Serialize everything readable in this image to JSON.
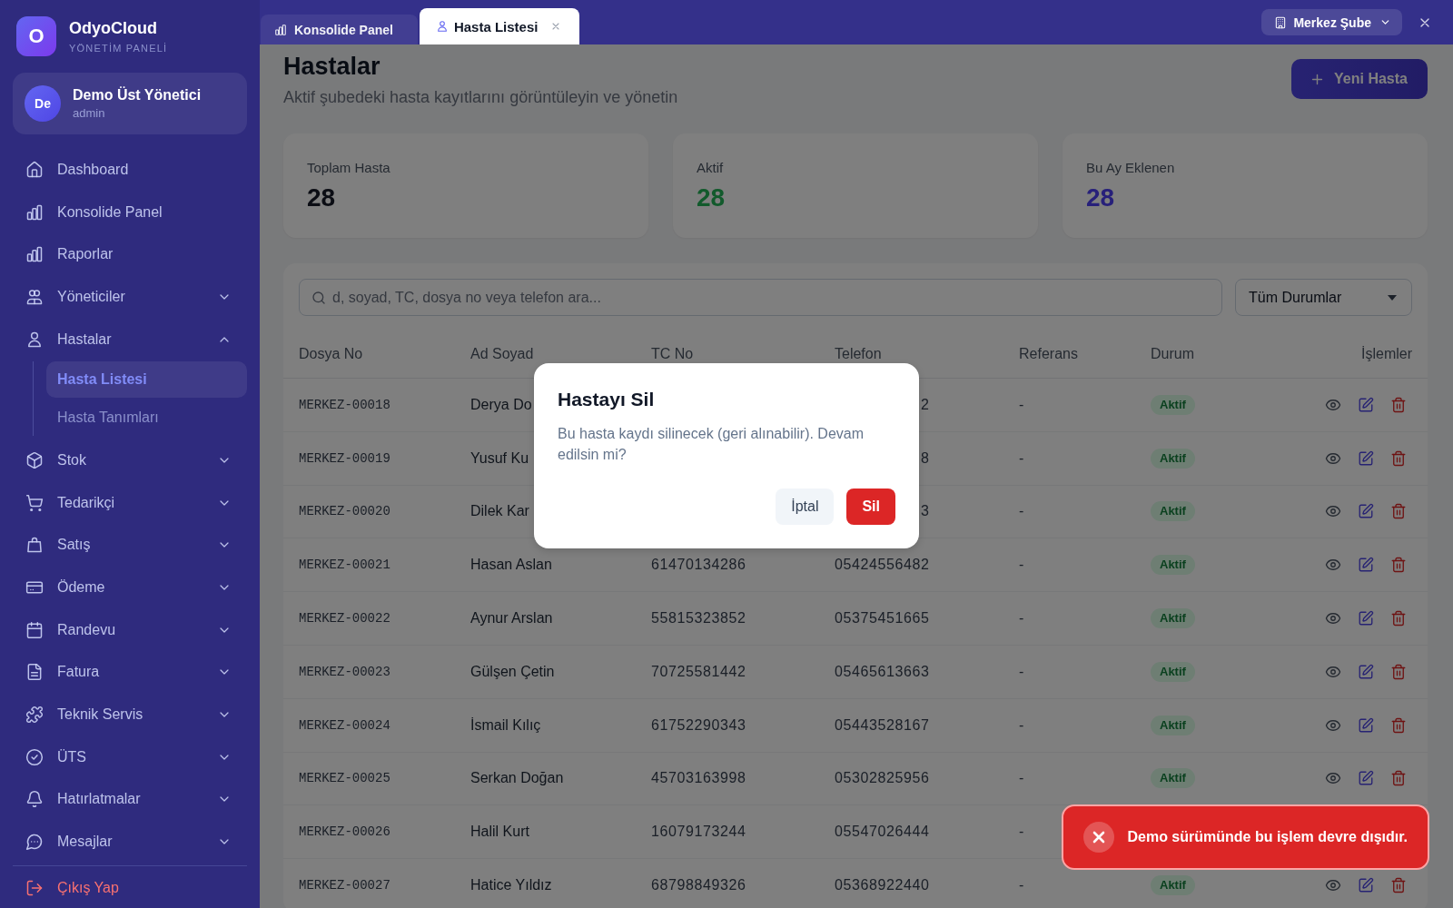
{
  "sidebar": {
    "brand": {
      "logo": "O",
      "name": "OdyoCloud",
      "tagline": "YÖNETİM PANELİ"
    },
    "user": {
      "initials": "De",
      "name": "Demo Üst Yönetici",
      "role": "admin"
    },
    "nav": [
      {
        "label": "Dashboard",
        "selected": false
      },
      {
        "label": "Konsolide Panel",
        "selected": false
      },
      {
        "label": "Raporlar",
        "selected": false
      },
      {
        "label": "Yöneticiler",
        "selected": false,
        "expanded": false
      },
      {
        "label": "Hastalar",
        "selected": false,
        "expanded": true,
        "children": [
          {
            "label": "Hasta Listesi",
            "selected": true
          },
          {
            "label": "Hasta Tanımları",
            "selected": false
          }
        ]
      },
      {
        "label": "Stok",
        "selected": false,
        "expanded": false
      },
      {
        "label": "Tedarikçi",
        "selected": false,
        "expanded": false
      },
      {
        "label": "Satış",
        "selected": false,
        "expanded": false
      },
      {
        "label": "Ödeme",
        "selected": false,
        "expanded": false
      },
      {
        "label": "Randevu",
        "selected": false,
        "expanded": false
      },
      {
        "label": "Fatura",
        "selected": false,
        "expanded": false
      },
      {
        "label": "Teknik Servis",
        "selected": false,
        "expanded": false
      },
      {
        "label": "ÜTS",
        "selected": false,
        "expanded": false
      },
      {
        "label": "Hatırlatmalar",
        "selected": false,
        "expanded": false
      },
      {
        "label": "Mesajlar",
        "selected": false,
        "expanded": false
      }
    ],
    "logout": "Çıkış Yap"
  },
  "topbar": {
    "tabs": [
      {
        "label": "Konsolide Panel",
        "selected": false,
        "closable": false
      },
      {
        "label": "Hasta Listesi",
        "selected": true,
        "closable": true
      }
    ],
    "branch": "Merkez Şube"
  },
  "page": {
    "title": "Hastalar",
    "subtitle": "Aktif şubedeki hasta kayıtlarını görüntüleyin ve yönetin",
    "new_button": "Yeni Hasta"
  },
  "stats": [
    {
      "label": "Toplam Hasta",
      "value": "28",
      "color": "#0b0d14"
    },
    {
      "label": "Aktif",
      "value": "28",
      "color": "#125a2c"
    },
    {
      "label": "Bu Ay Eklenen",
      "value": "28",
      "color": "#27207a"
    }
  ],
  "filters": {
    "search": {
      "placeholder": "d, soyad, TC, dosya no veya telefon ara..."
    },
    "status_select": "Tüm Durumlar"
  },
  "table": {
    "columns": [
      "Dosya No",
      "Ad Soyad",
      "TC No",
      "Telefon",
      "Referans",
      "Durum",
      "İşlemler"
    ],
    "rows": [
      {
        "file_no": "MERKEZ-00018",
        "name": "Derya Do",
        "phone": "2",
        "reference": "-",
        "status": "Aktif",
        "actions": [
          {
            "kind": "view"
          },
          {
            "kind": "edit"
          },
          {
            "kind": "delete"
          }
        ]
      },
      {
        "file_no": "MERKEZ-00019",
        "name": "Yusuf Ku",
        "phone": "8",
        "reference": "-",
        "status": "Aktif",
        "actions": [
          {
            "kind": "view"
          },
          {
            "kind": "edit"
          },
          {
            "kind": "delete"
          }
        ]
      },
      {
        "file_no": "MERKEZ-00020",
        "name": "Dilek Kar",
        "phone": "3",
        "reference": "-",
        "status": "Aktif",
        "actions": [
          {
            "kind": "view"
          },
          {
            "kind": "edit"
          },
          {
            "kind": "delete"
          }
        ]
      },
      {
        "file_no": "MERKEZ-00021",
        "name": "Hasan Aslan",
        "tc": "61470134286",
        "phone": "05424556482",
        "reference": "-",
        "status": "Aktif",
        "actions": [
          {
            "kind": "view"
          },
          {
            "kind": "edit"
          },
          {
            "kind": "delete"
          }
        ]
      },
      {
        "file_no": "MERKEZ-00022",
        "name": "Aynur Arslan",
        "tc": "55815323852",
        "phone": "05375451665",
        "reference": "-",
        "status": "Aktif",
        "actions": [
          {
            "kind": "view"
          },
          {
            "kind": "edit"
          },
          {
            "kind": "delete"
          }
        ]
      },
      {
        "file_no": "MERKEZ-00023",
        "name": "Gülşen Çetin",
        "tc": "70725581442",
        "phone": "05465613663",
        "reference": "-",
        "status": "Aktif",
        "actions": [
          {
            "kind": "view"
          },
          {
            "kind": "edit"
          },
          {
            "kind": "delete"
          }
        ]
      },
      {
        "file_no": "MERKEZ-00024",
        "name": "İsmail Kılıç",
        "tc": "61752290343",
        "phone": "05443528167",
        "reference": "-",
        "status": "Aktif",
        "actions": [
          {
            "kind": "view"
          },
          {
            "kind": "edit"
          },
          {
            "kind": "delete"
          }
        ]
      },
      {
        "file_no": "MERKEZ-00025",
        "name": "Serkan Doğan",
        "tc": "45703163998",
        "phone": "05302825956",
        "reference": "-",
        "status": "Aktif",
        "actions": [
          {
            "kind": "view"
          },
          {
            "kind": "edit"
          },
          {
            "kind": "delete"
          }
        ]
      },
      {
        "file_no": "MERKEZ-00026",
        "name": "Halil Kurt",
        "tc": "16079173244",
        "phone": "05547026444",
        "reference": "-"
      },
      {
        "file_no": "MERKEZ-00027",
        "name": "Hatice Yıldız",
        "tc": "68798849326",
        "phone": "05368922440",
        "reference": "-",
        "status": "Aktif",
        "actions": [
          {
            "kind": "view"
          },
          {
            "kind": "edit"
          },
          {
            "kind": "delete"
          }
        ]
      }
    ]
  },
  "dialog": {
    "title": "Hastayı Sil",
    "message": "Bu hasta kaydı silinecek (geri alınabilir). Devam edilsin mi?",
    "buttons": [
      {
        "label": "İptal",
        "kind": "secondary"
      },
      {
        "label": "Sil",
        "kind": "danger"
      }
    ]
  },
  "toast": {
    "kind": "error",
    "message": "Demo sürümünde bu işlem devre dışıdır."
  }
}
